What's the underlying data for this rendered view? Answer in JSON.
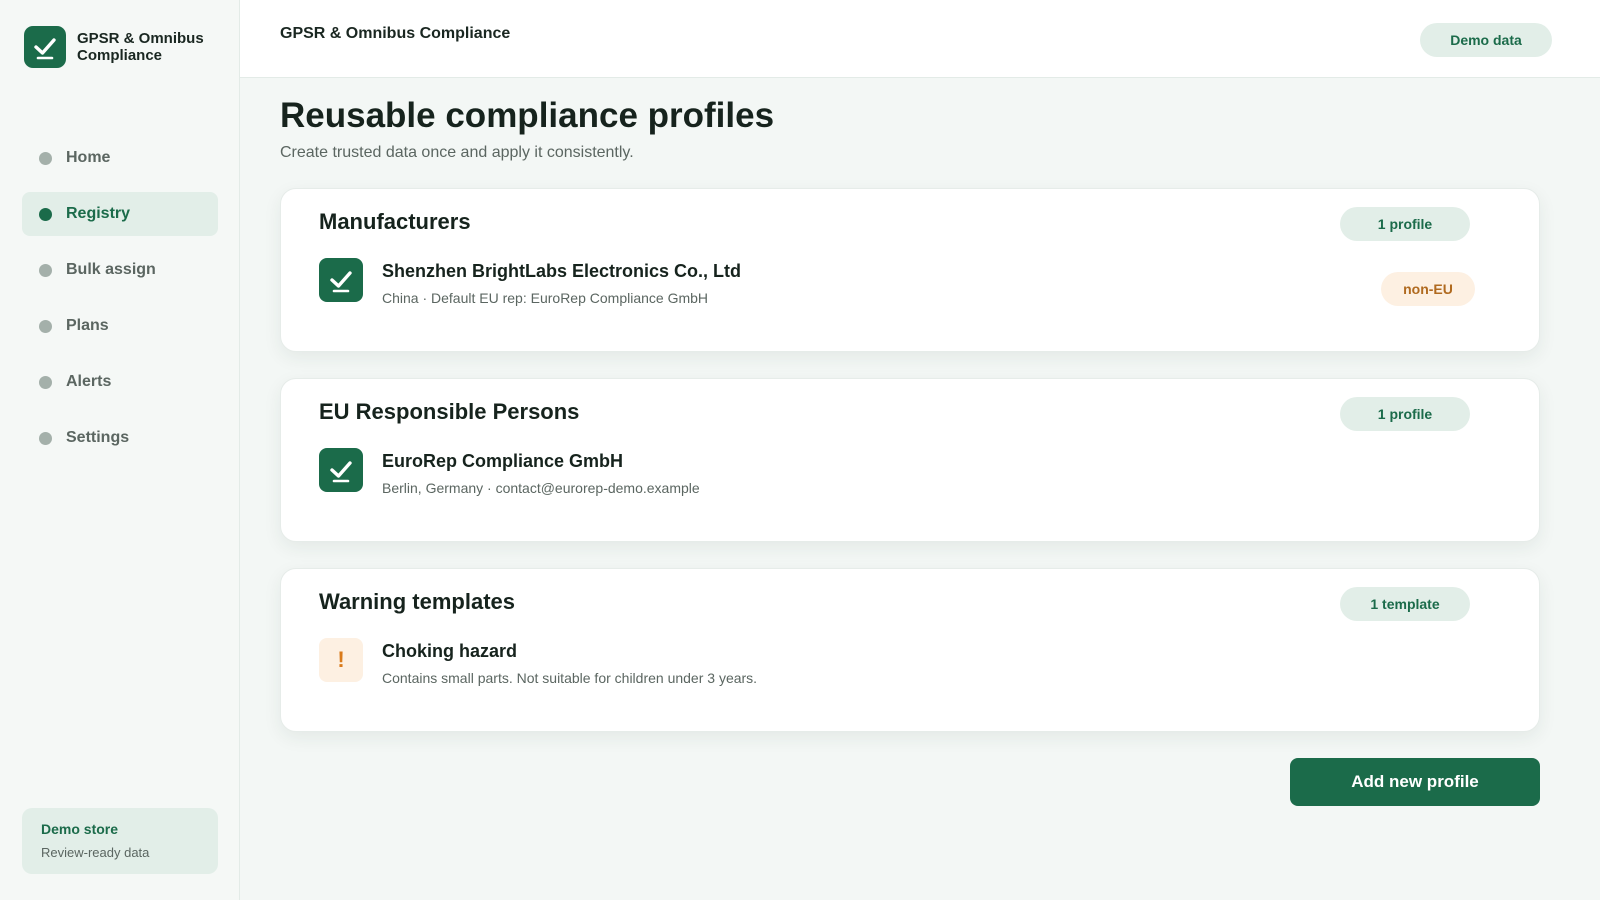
{
  "app": {
    "name": "GPSR & Omnibus Compliance"
  },
  "sidebar": {
    "items": [
      {
        "label": "Home"
      },
      {
        "label": "Registry",
        "active": true
      },
      {
        "label": "Bulk assign"
      },
      {
        "label": "Plans"
      },
      {
        "label": "Alerts"
      },
      {
        "label": "Settings"
      }
    ],
    "store": {
      "title": "Demo store",
      "subtitle": "Review-ready data"
    }
  },
  "header": {
    "title": "GPSR & Omnibus Compliance",
    "badge": "Demo data"
  },
  "main": {
    "title": "Reusable compliance profiles",
    "subtitle": "Create trusted data once and apply it consistently.",
    "sections": [
      {
        "title": "Manufacturers",
        "count": "1 profile",
        "item": {
          "name": "Shenzhen BrightLabs Electronics Co., Ltd",
          "meta": "China · Default EU rep: EuroRep Compliance GmbH",
          "tag": "non-EU",
          "icon": "check-icon"
        }
      },
      {
        "title": "EU Responsible Persons",
        "count": "1 profile",
        "item": {
          "name": "EuroRep Compliance GmbH",
          "meta": "Berlin, Germany · contact@eurorep-demo.example",
          "icon": "check-icon"
        }
      },
      {
        "title": "Warning templates",
        "count": "1 template",
        "item": {
          "name": "Choking hazard",
          "meta": "Contains small parts. Not suitable for children under 3 years.",
          "icon": "warning-icon",
          "glyph": "!"
        }
      }
    ],
    "primary_action": "Add new profile"
  },
  "colors": {
    "accent": "#1b6b4a",
    "accent_soft": "#e2eee8",
    "warning": "#d97a1a",
    "warning_soft": "#fdf0e2"
  }
}
